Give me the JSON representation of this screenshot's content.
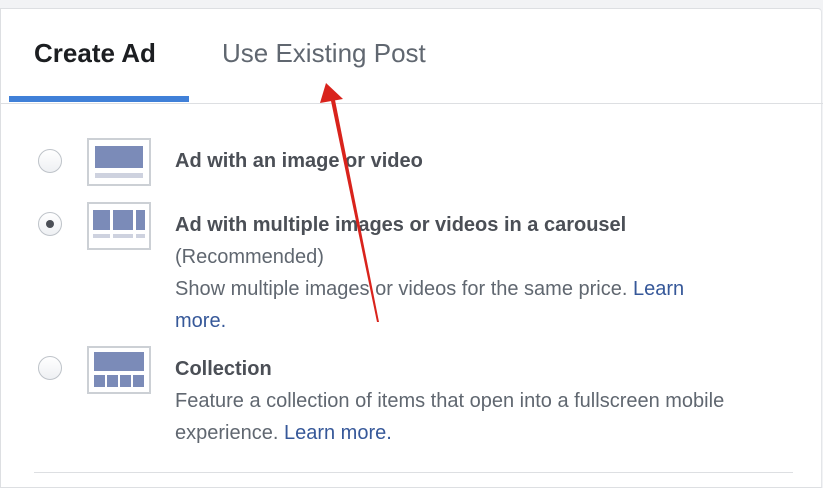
{
  "tabs": {
    "create_ad": "Create Ad",
    "use_existing_post": "Use Existing Post",
    "active": "create_ad"
  },
  "options": [
    {
      "title": "Ad with an image or video",
      "selected": false
    },
    {
      "title": "Ad with multiple images or videos in a carousel",
      "recommended": "(Recommended)",
      "description_line1": "Show multiple images or videos for the same price.",
      "learn_more_part1": "Learn",
      "learn_more_part2": "more.",
      "selected": true
    },
    {
      "title": "Collection",
      "description_line1": "Feature a collection of items that open into a fullscreen mobile",
      "description_line2": "experience.",
      "learn_more": "Learn more.",
      "selected": false
    }
  ],
  "icons": {
    "single": "single-image-icon",
    "carousel": "carousel-icon",
    "collection": "collection-icon",
    "annotation": "red-arrow-annotation"
  },
  "colors": {
    "accent": "#4080d8",
    "link": "#365899",
    "thumb_fill": "#7b8bb8",
    "thumb_strip": "#ced2df",
    "arrow": "#d9231c"
  }
}
